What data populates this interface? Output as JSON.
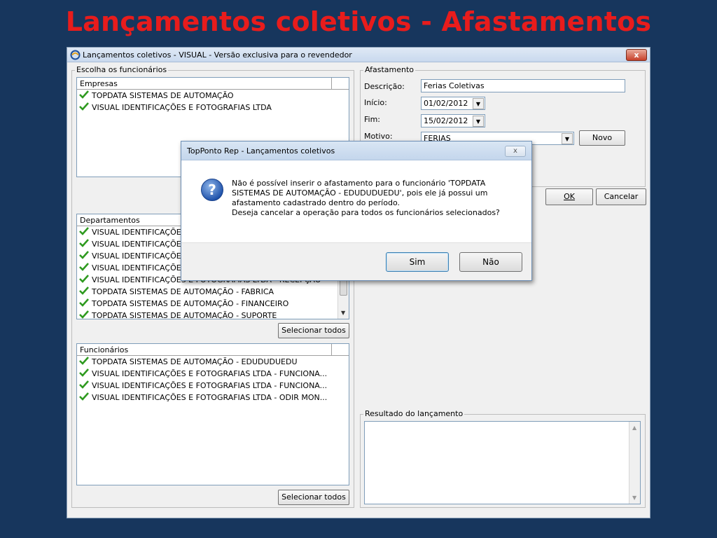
{
  "slide": {
    "title": "Lançamentos coletivos - Afastamentos"
  },
  "window": {
    "title": "Lançamentos coletivos - VISUAL - Versão exclusiva para o revendedor",
    "close": "x"
  },
  "employees_group": {
    "legend": "Escolha os funcionários",
    "companies": {
      "header": "Empresas",
      "items": [
        "TOPDATA SISTEMAS DE AUTOMAÇÃO",
        "VISUAL IDENTIFICAÇÕES E FOTOGRAFIAS LTDA"
      ]
    },
    "departments": {
      "header": "Departamentos",
      "items": [
        "VISUAL IDENTIFICAÇÕE",
        "VISUAL IDENTIFICAÇÕE",
        "VISUAL IDENTIFICAÇÕE",
        "VISUAL IDENTIFICAÇÕE",
        "VISUAL IDENTIFICAÇÕES E FOTOGRAFIAS LTDA - RECEPÇÃO",
        "TOPDATA SISTEMAS DE AUTOMAÇÃO - FABRICA",
        "TOPDATA SISTEMAS DE AUTOMAÇÃO - FINANCEIRO",
        "TOPDATA SISTEMAS DE AUTOMAÇÃO - SUPORTE"
      ],
      "select_all": "Selecionar todos"
    },
    "employees": {
      "header": "Funcionários",
      "items": [
        "TOPDATA SISTEMAS DE AUTOMAÇÃO - EDUDUDUEDU",
        "VISUAL IDENTIFICAÇÕES E FOTOGRAFIAS LTDA - FUNCIONA...",
        "VISUAL IDENTIFICAÇÕES E FOTOGRAFIAS LTDA - FUNCIONA...",
        "VISUAL IDENTIFICAÇÕES E FOTOGRAFIAS LTDA - ODIR MON..."
      ],
      "select_all": "Selecionar todos"
    }
  },
  "absence_group": {
    "legend": "Afastamento",
    "description_label": "Descrição:",
    "description_value": "Ferias Coletivas",
    "start_label": "Início:",
    "start_value": "01/02/2012",
    "end_label": "Fim:",
    "end_value": "15/02/2012",
    "reason_label": "Motivo:",
    "reason_value": "FERIAS",
    "new_button": "Novo"
  },
  "actions": {
    "ok": "OK",
    "cancel": "Cancelar"
  },
  "result_group": {
    "legend": "Resultado do lançamento"
  },
  "dialog": {
    "title": "TopPonto Rep - Lançamentos coletivos",
    "close": "x",
    "message_lines": [
      "Não é possível inserir o afastamento para o funcionário 'TOPDATA",
      "SISTEMAS DE AUTOMAÇÃO - EDUDUDUEDU', pois ele já possui um",
      "afastamento cadastrado dentro do período.",
      "Deseja cancelar a operação para todos os funcionários selecionados?"
    ],
    "yes": "Sim",
    "no": "Não"
  },
  "colors": {
    "background": "#17365d",
    "title": "#e81c1c",
    "check": "#2e9a1f"
  }
}
